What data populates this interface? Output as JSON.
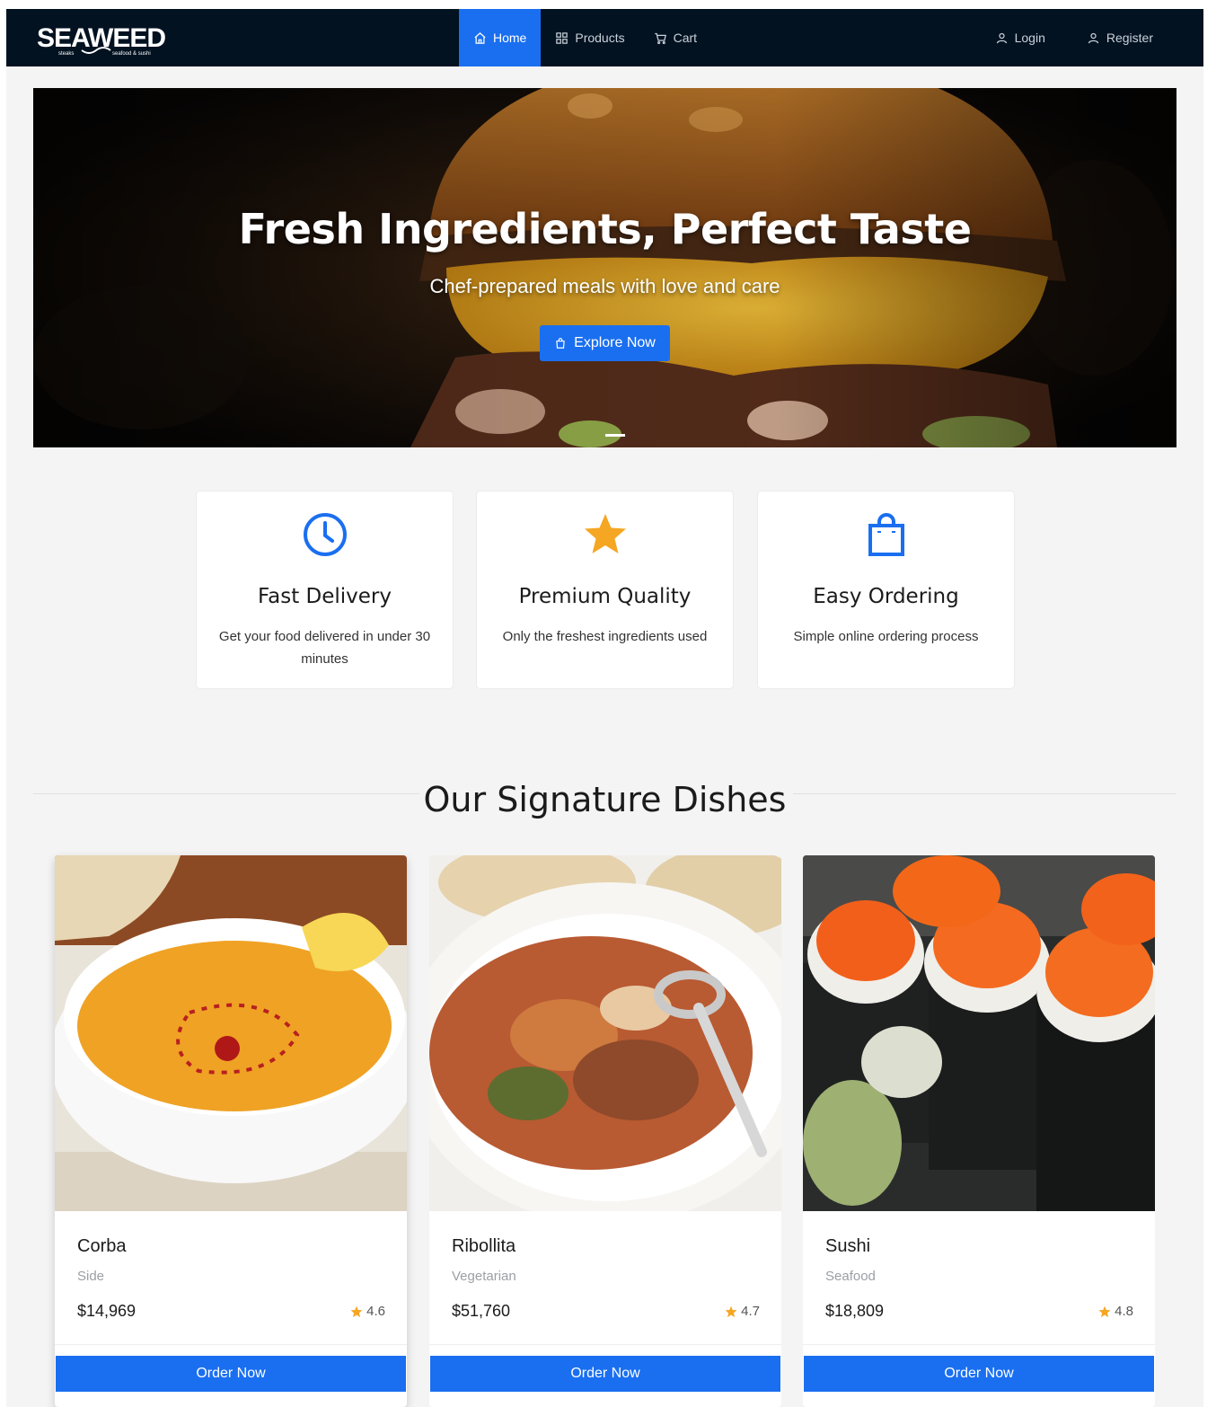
{
  "brand": {
    "name": "SEAWEED",
    "tagline_left": "steaks",
    "tagline_right": "seafood & sushi"
  },
  "nav": {
    "center": [
      {
        "label": "Home",
        "icon": "home-icon",
        "active": true
      },
      {
        "label": "Products",
        "icon": "grid-icon",
        "active": false
      },
      {
        "label": "Cart",
        "icon": "cart-icon",
        "active": false
      }
    ],
    "right": [
      {
        "label": "Login",
        "icon": "user-icon"
      },
      {
        "label": "Register",
        "icon": "user-icon"
      }
    ]
  },
  "hero": {
    "title": "Fresh Ingredients, Perfect Taste",
    "subtitle": "Chef-prepared meals with love and care",
    "button": "Explore Now",
    "button_icon": "shopping-bag-icon"
  },
  "features": [
    {
      "icon": "clock-icon",
      "title": "Fast Delivery",
      "text": "Get your food delivered in under 30 minutes"
    },
    {
      "icon": "star-icon",
      "title": "Premium Quality",
      "text": "Only the freshest ingredients used"
    },
    {
      "icon": "shopping-bag-icon",
      "title": "Easy Ordering",
      "text": "Simple online ordering process"
    }
  ],
  "section": {
    "title": "Our Signature Dishes"
  },
  "dishes": [
    {
      "name": "Corba",
      "category": "Side",
      "price": "$14,969",
      "rating": "4.6",
      "button": "Order Now"
    },
    {
      "name": "Ribollita",
      "category": "Vegetarian",
      "price": "$51,760",
      "rating": "4.7",
      "button": "Order Now"
    },
    {
      "name": "Sushi",
      "category": "Seafood",
      "price": "$18,809",
      "rating": "4.8",
      "button": "Order Now"
    }
  ],
  "colors": {
    "primary": "#1a6ff0",
    "navbar": "#021221",
    "star": "#f5a623",
    "page_bg": "#f4f4f4"
  }
}
